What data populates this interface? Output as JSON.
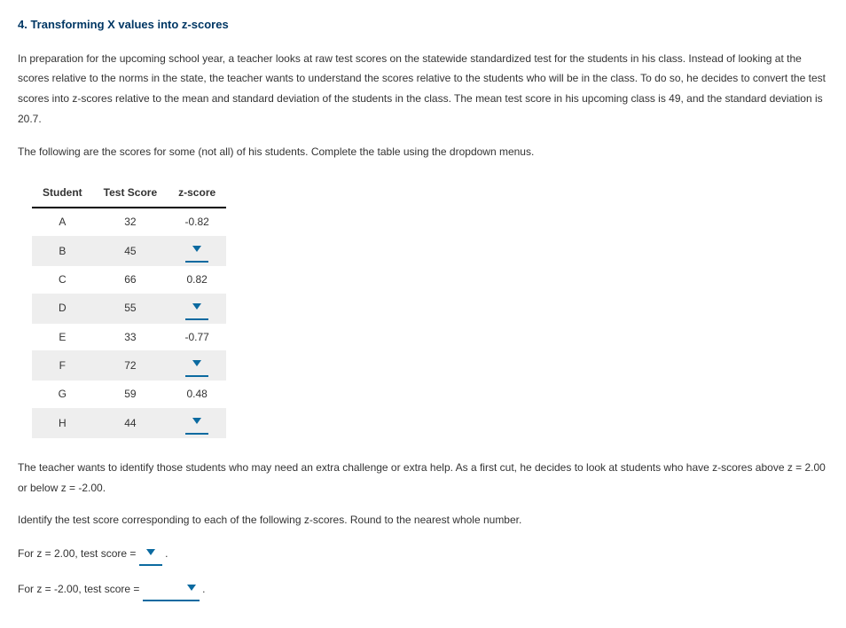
{
  "heading": "4. Transforming X values into z-scores",
  "intro": "In preparation for the upcoming school year, a teacher looks at raw test scores on the statewide standardized test for the students in his class. Instead of looking at the scores relative to the norms in the state, the teacher wants to understand the scores relative to the students who will be in the class. To do so, he decides to convert the test scores into z-scores relative to the mean and standard deviation of the students in the class. The mean test score in his upcoming class is 49, and the standard deviation is 20.7.",
  "instructions": "The following are the scores for some (not all) of his students. Complete the table using the dropdown menus.",
  "table": {
    "headers": {
      "c0": "Student",
      "c1": "Test Score",
      "c2": "z-score"
    },
    "rows": [
      {
        "student": "A",
        "score": "32",
        "z": "-0.82",
        "dropdown": false
      },
      {
        "student": "B",
        "score": "45",
        "z": "",
        "dropdown": true
      },
      {
        "student": "C",
        "score": "66",
        "z": "0.82",
        "dropdown": false
      },
      {
        "student": "D",
        "score": "55",
        "z": "",
        "dropdown": true
      },
      {
        "student": "E",
        "score": "33",
        "z": "-0.77",
        "dropdown": false
      },
      {
        "student": "F",
        "score": "72",
        "z": "",
        "dropdown": true
      },
      {
        "student": "G",
        "score": "59",
        "z": "0.48",
        "dropdown": false
      },
      {
        "student": "H",
        "score": "44",
        "z": "",
        "dropdown": true
      }
    ]
  },
  "followup1": "The teacher wants to identify those students who may need an extra challenge or extra help. As a first cut, he decides to look at students who have z-scores above z = 2.00 or below z = -2.00.",
  "followup2": "Identify the test score corresponding to each of the following z-scores. Round to the nearest whole number.",
  "q1_pre": "For z = 2.00, test score = ",
  "q1_post": " .",
  "q2_pre": "For z = -2.00, test score = ",
  "q2_post": " ."
}
